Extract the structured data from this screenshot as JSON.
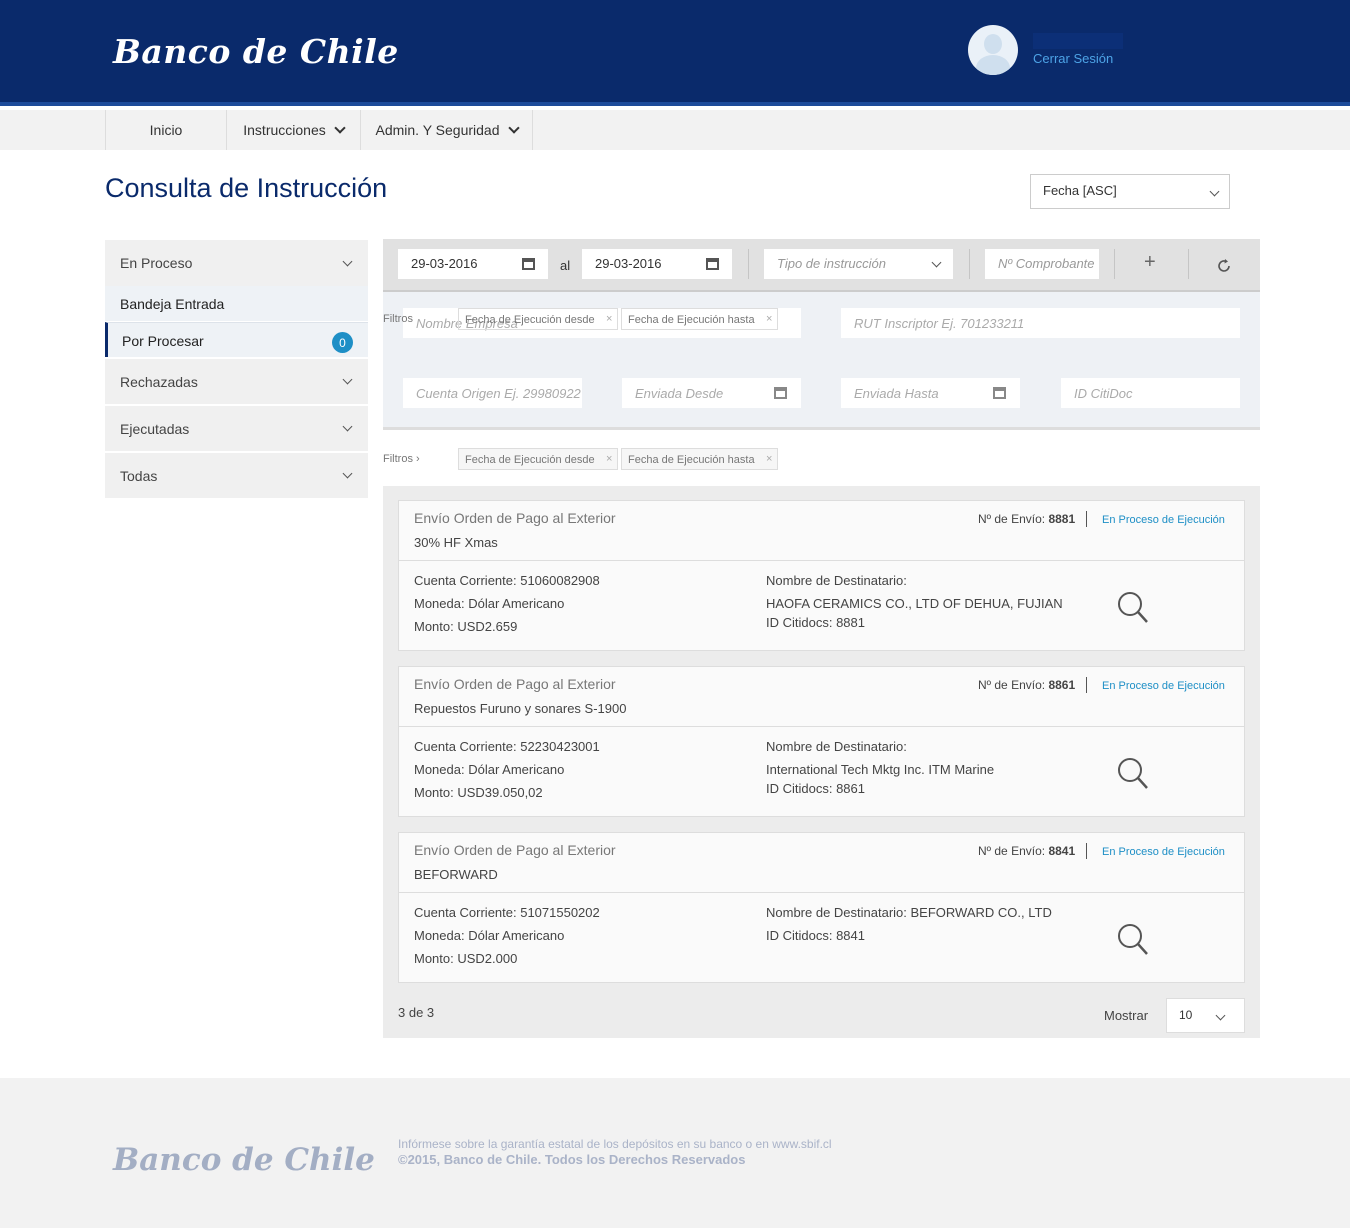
{
  "header": {
    "brand": "Banco de Chile",
    "logout": "Cerrar Sesión"
  },
  "nav": {
    "items": [
      {
        "label": "Inicio"
      },
      {
        "label": "Instrucciones"
      },
      {
        "label": "Admin. Y Seguridad"
      }
    ]
  },
  "page": {
    "title": "Consulta de Instrucción",
    "sort": "Fecha [ASC]"
  },
  "sidebar": {
    "groups": [
      {
        "label": "En Proceso"
      },
      {
        "label": "Rechazadas"
      },
      {
        "label": "Ejecutadas"
      },
      {
        "label": "Todas"
      }
    ],
    "subs": [
      {
        "label": "Bandeja Entrada"
      },
      {
        "label": "Por Procesar",
        "badge": "0"
      }
    ]
  },
  "filterbar": {
    "date_from": "29-03-2016",
    "al": "al",
    "date_to": "29-03-2016",
    "tipo_placeholder": "Tipo de instrucción",
    "comprobante_placeholder": "Nº Comprobante",
    "add": "+"
  },
  "advanced": {
    "empresa_placeholder": "Nombre Empresa",
    "rut_placeholder": "RUT Inscriptor Ej. 701233211",
    "cuenta_placeholder": "Cuenta Origen Ej. 29980922",
    "desde_placeholder": "Enviada Desde",
    "hasta_placeholder": "Enviada Hasta",
    "citidoc_placeholder": "ID CitiDoc"
  },
  "filters": {
    "label": "Filtros",
    "chips": [
      "Fecha de Ejecución desde",
      "Fecha de Ejecución hasta"
    ]
  },
  "cards": [
    {
      "title": "Envío Orden de Pago al Exterior",
      "subtitle": "30% HF Xmas",
      "envio_label": "Nº de Envío:",
      "envio_num": "8881",
      "status": "En Proceso de Ejecución",
      "cuenta": "Cuenta Corriente: 51060082908",
      "moneda": "Moneda: Dólar Americano",
      "monto": "Monto: USD2.659",
      "dest_label": "Nombre de Destinatario:",
      "dest": "HAOFA CERAMICS CO., LTD OF DEHUA, FUJIAN",
      "citidocs": "ID Citidocs: 8881"
    },
    {
      "title": "Envío Orden de Pago al Exterior",
      "subtitle": "Repuestos Furuno y sonares S-1900",
      "envio_label": "Nº de Envío:",
      "envio_num": "8861",
      "status": "En Proceso de Ejecución",
      "cuenta": "Cuenta Corriente: 52230423001",
      "moneda": "Moneda: Dólar Americano",
      "monto": "Monto: USD39.050,02",
      "dest_label": "Nombre de Destinatario:",
      "dest": "International Tech Mktg Inc. ITM Marine",
      "citidocs": "ID Citidocs: 8861"
    },
    {
      "title": "Envío Orden de Pago al Exterior",
      "subtitle": "BEFORWARD",
      "envio_label": "Nº de Envío:",
      "envio_num": "8841",
      "status": "En Proceso de Ejecución",
      "cuenta": "Cuenta Corriente: 51071550202",
      "moneda": "Moneda: Dólar Americano",
      "monto": "Monto: USD2.000",
      "dest_label": "Nombre de Destinatario: BEFORWARD CO., LTD",
      "dest": "",
      "citidocs": "ID Citidocs: 8841"
    }
  ],
  "pagination": {
    "count": "3 de 3",
    "mostrar": "Mostrar",
    "per_page": "10"
  },
  "footer": {
    "brand": "Banco de Chile",
    "line1": "Infórmese sobre la garantía estatal de los depósitos en su banco o en www.sbif.cl",
    "line2": "©2015, Banco de Chile. Todos los Derechos Reservados"
  },
  "colors": {
    "brand_navy": "#0a2a6b",
    "accent_blue": "#1e8fc6"
  }
}
